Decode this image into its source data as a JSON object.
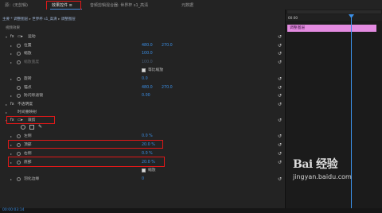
{
  "tabs": [
    {
      "label": "源：(无剪辑)"
    },
    {
      "label": "效果控件 ≡"
    },
    {
      "label": "音频剪辑混合器: 世界杯 s1_高清"
    },
    {
      "label": "元数据"
    }
  ],
  "breadcrumb": {
    "master": "主要 * 调整图层",
    "sep1": "▸",
    "seq": "世界杯 s1_高清",
    "sep2": "▸",
    "clip": "调整图层"
  },
  "section_header": "视频效果",
  "rows": [
    {
      "arrow": "▾",
      "fx": "fx",
      "stopwatch": false,
      "icon": "▭▸",
      "label": "运动"
    },
    {
      "arrow": "▸",
      "stopwatch": true,
      "label": "位置",
      "v1": "480.0",
      "v2": "270.0"
    },
    {
      "arrow": "▸",
      "stopwatch": true,
      "label": "缩放",
      "v1": "100.0"
    },
    {
      "arrow": "▸",
      "stopwatch": true,
      "label": "缩放宽度",
      "v1": "100.0",
      "dim": true
    },
    {
      "checkbox": true,
      "checklabel": "等比缩放"
    },
    {
      "arrow": "▸",
      "stopwatch": true,
      "label": "旋转",
      "v1": "0.0"
    },
    {
      "stopwatch": true,
      "label": "锚点",
      "v1": "480.0",
      "v2": "270.0"
    },
    {
      "arrow": "▸",
      "stopwatch": true,
      "label": "防闪烁滤镜",
      "v1": "0.00"
    },
    {
      "arrow": "▸",
      "fx": "fx",
      "label": "不透明度"
    },
    {
      "arrow": "▸",
      "fx": "",
      "label": "时间重映射"
    },
    {
      "arrow": "▾",
      "fx": "fx",
      "icon": "▭▸",
      "label": "裁剪"
    },
    {
      "arrow": "▸",
      "stopwatch": true,
      "label": "左侧",
      "v1": "0.0 %"
    },
    {
      "arrow": "▸",
      "stopwatch": true,
      "label": "顶部",
      "v1": "20.0 %"
    },
    {
      "arrow": "▸",
      "stopwatch": true,
      "label": "右侧",
      "v1": "0.0 %"
    },
    {
      "arrow": "▸",
      "stopwatch": true,
      "label": "底部",
      "v1": "20.0 %"
    },
    {
      "checkbox": true,
      "checklabel": "缩放"
    },
    {
      "arrow": "▸",
      "stopwatch": true,
      "label": "羽化边缘",
      "v1": "0"
    }
  ],
  "tools": {
    "ellipse": "ellipse-mask-tool",
    "rect": "rect-mask-tool",
    "pen": "✎"
  },
  "reset_glyph": "↺",
  "timeline": {
    "time": "00:00",
    "clip_label": "调整图层",
    "clip_color": "#e38be0",
    "playhead_color": "#3b8fe6"
  },
  "status": {
    "timecode": "00:00:03:14"
  },
  "watermark": {
    "brand": "Bai 经验",
    "url": "jingyan.baidu.com"
  },
  "colors": {
    "accent": "#3b8fe6",
    "highlight": "#e01818"
  }
}
